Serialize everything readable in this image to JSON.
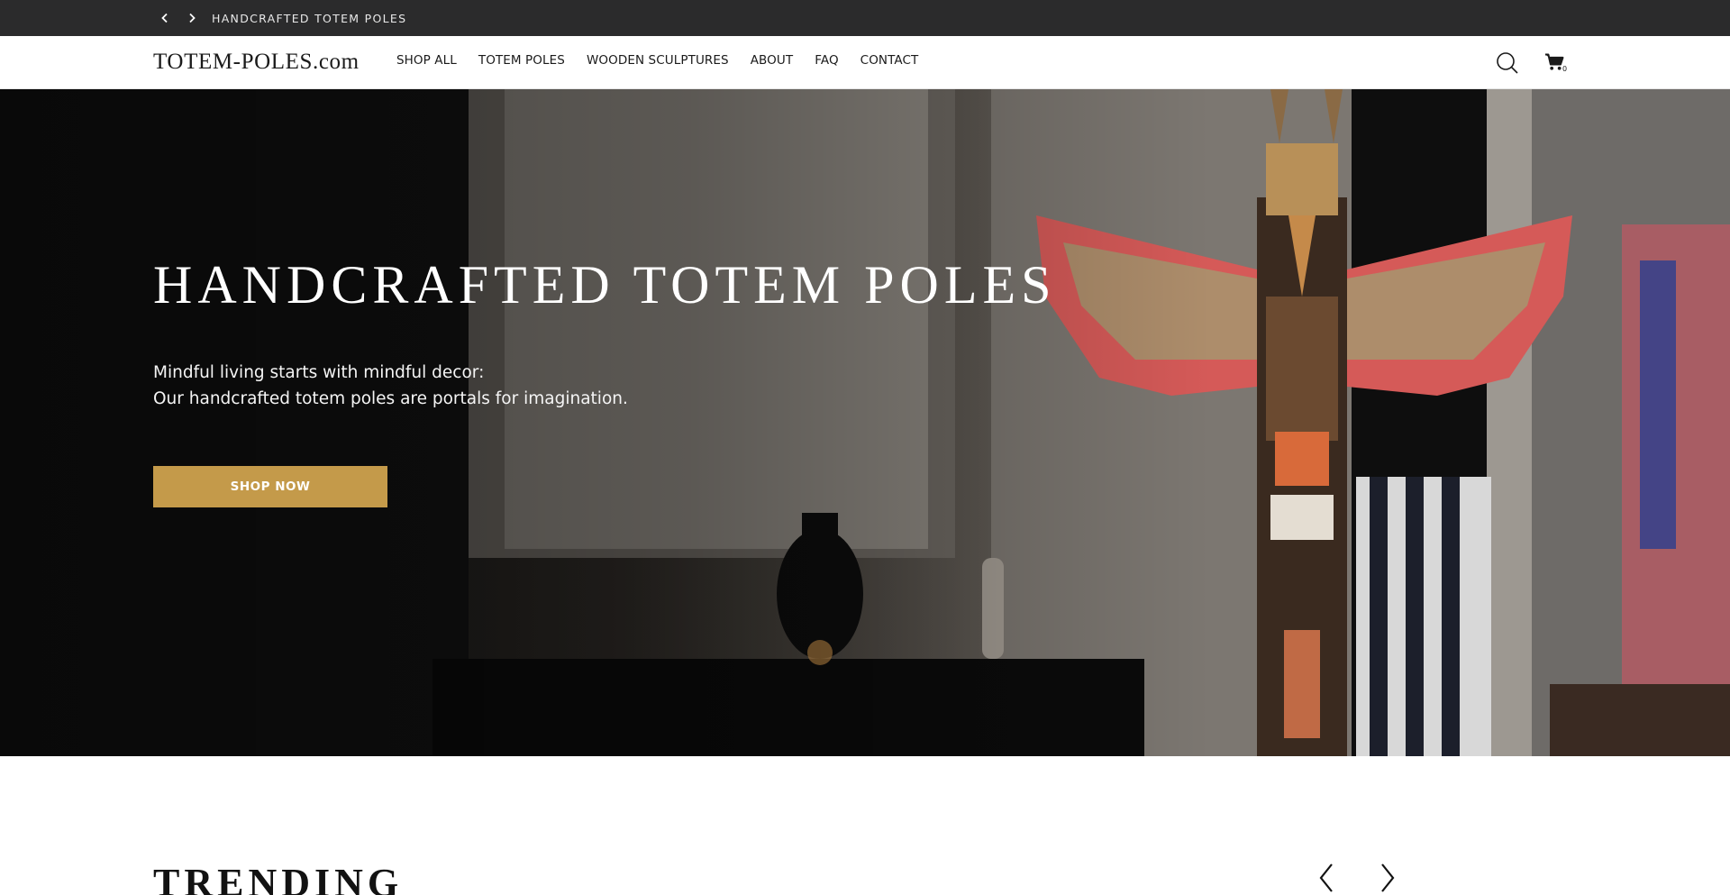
{
  "announcement": {
    "message": "HANDCRAFTED TOTEM POLES",
    "prev_icon": "chevron-left-icon",
    "next_icon": "chevron-right-icon"
  },
  "header": {
    "logo": "TOTEM-POLES.com",
    "nav": [
      "SHOP ALL",
      "TOTEM POLES",
      "WOODEN SCULPTURES",
      "ABOUT",
      "FAQ",
      "CONTACT"
    ],
    "search_icon": "search-icon",
    "cart_icon": "cart-icon",
    "cart_count": "0"
  },
  "hero": {
    "title": "HANDCRAFTED TOTEM POLES",
    "subtitle_line1": "Mindful living starts with mindful decor:",
    "subtitle_line2": "Our handcrafted totem poles are portals for imagination.",
    "cta_label": "SHOP NOW"
  },
  "trending": {
    "title": "TRENDING",
    "prev_icon": "chevron-left-icon",
    "next_icon": "chevron-right-icon"
  },
  "colors": {
    "announcement_bg": "#2b2b2c",
    "accent": "#c49a4a",
    "text": "#121212"
  }
}
